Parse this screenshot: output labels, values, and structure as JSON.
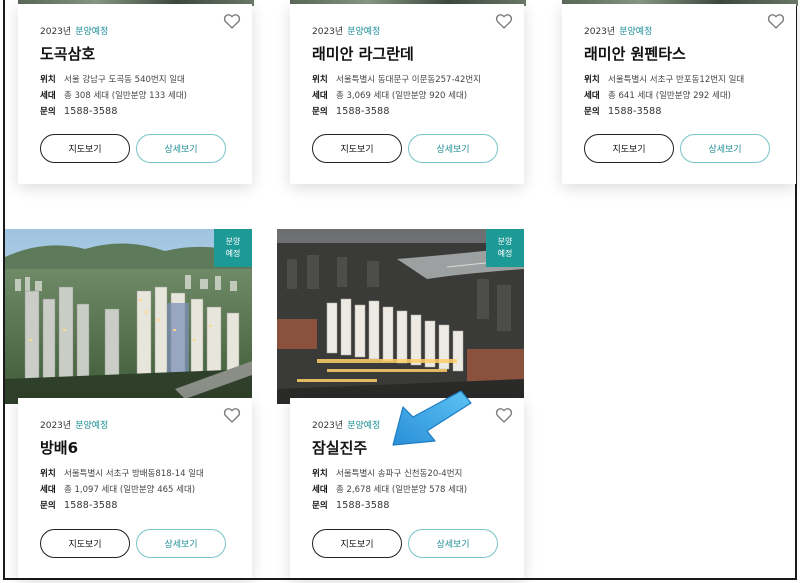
{
  "labels": {
    "location": "위치",
    "households": "세대",
    "inquiry": "문의",
    "map_button": "지도보기",
    "detail_button": "상세보기"
  },
  "badge": {
    "line1": "분양",
    "line2": "예정"
  },
  "colors": {
    "accent": "#1e8f96",
    "badge_bg": "#1e9a96",
    "arrow": "#39a8e6"
  },
  "icons": {
    "favorite": "heart-outline-icon",
    "annotation": "blue-arrow-icon"
  },
  "cards": [
    {
      "year": "2023년",
      "status": "분양예정",
      "name": "도곡삼호",
      "location": "서울 강남구 도곡동 540번지 일대",
      "households": "총 308 세대 (일반분양 133 세대)",
      "phone": "1588-3588"
    },
    {
      "year": "2023년",
      "status": "분양예정",
      "name": "래미안 라그란데",
      "location": "서울특별시 동대문구 이문동257-42번지",
      "households": "총 3,069 세대 (일반분양 920 세대)",
      "phone": "1588-3588"
    },
    {
      "year": "2023년",
      "status": "분양예정",
      "name": "래미안 원펜타스",
      "location": "서울특별시 서초구 반포동12번지 일대",
      "households": "총 641 세대 (일반분양 292 세대)",
      "phone": "1588-3588"
    },
    {
      "year": "2023년",
      "status": "분양예정",
      "name": "방배6",
      "location": "서울특별시 서초구 방배동818-14 일대",
      "households": "총 1,097 세대 (일반분양 465 세대)",
      "phone": "1588-3588"
    },
    {
      "year": "2023년",
      "status": "분양예정",
      "name": "잠실진주",
      "location": "서울특별시 송파구 신천동20-4번지",
      "households": "총 2,678 세대 (일반분양 578 세대)",
      "phone": "1588-3588"
    }
  ]
}
